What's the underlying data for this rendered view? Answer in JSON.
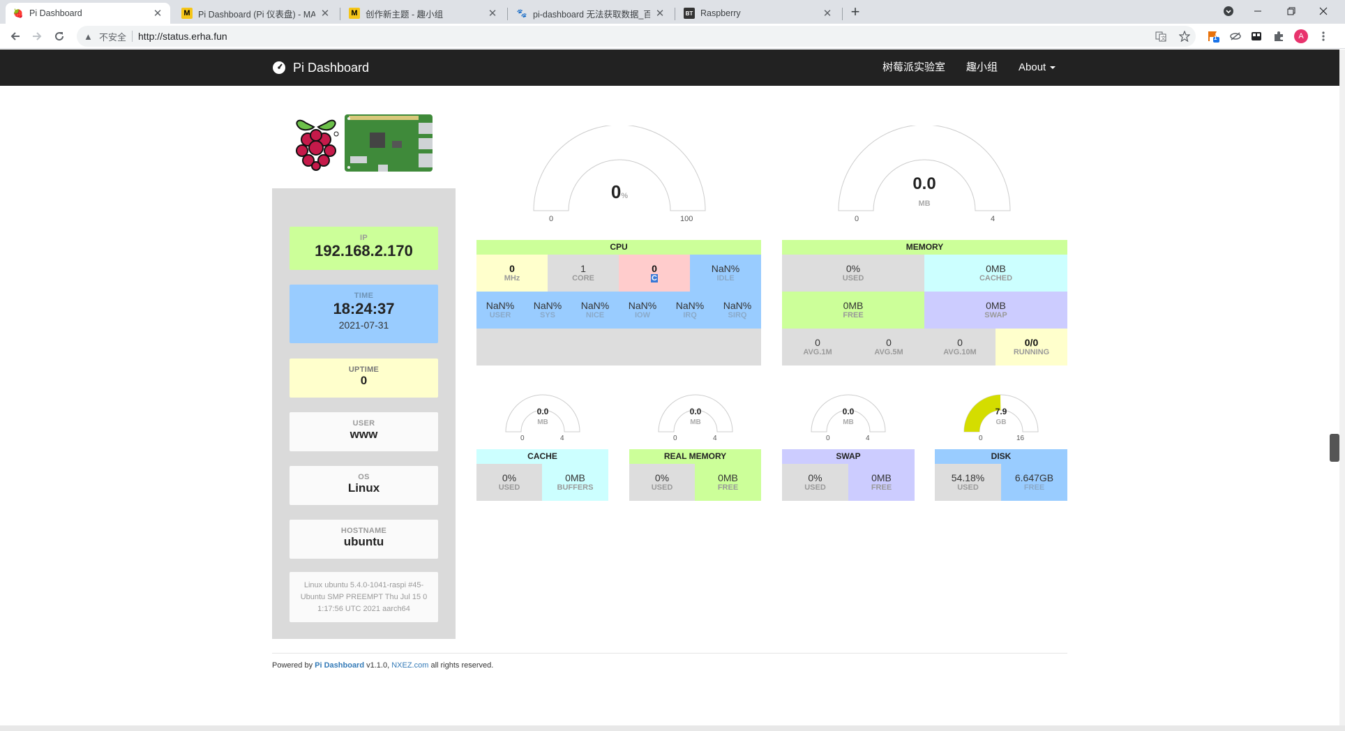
{
  "browser": {
    "tabs": [
      {
        "title": "Pi Dashboard",
        "active": true
      },
      {
        "title": "Pi Dashboard (Pi 仪表盘) - MA"
      },
      {
        "title": "创作新主题 - 趣小组"
      },
      {
        "title": "pi-dashboard 无法获取数据_百"
      },
      {
        "title": "Raspberry"
      }
    ],
    "favicons": [
      "🍓",
      "M",
      "M",
      "🐾",
      "BT"
    ],
    "new_tab": "+",
    "not_secure": "不安全",
    "url": "http://status.erha.fun",
    "profile_initial": "A",
    "ext_badge": "1"
  },
  "navbar": {
    "brand": "Pi Dashboard",
    "links": [
      "树莓派实验室",
      "趣小组",
      "About"
    ]
  },
  "sidebar": {
    "ip_label": "IP",
    "ip": "192.168.2.170",
    "time_label": "TIME",
    "time": "18:24:37",
    "date": "2021-07-31",
    "uptime_label": "UPTIME",
    "uptime": "0",
    "user_label": "USER",
    "user": "www",
    "os_label": "OS",
    "os": "Linux",
    "hostname_label": "HOSTNAME",
    "hostname": "ubuntu",
    "kernel_lines": [
      "Linux ubuntu 5.4.0-1041-raspi #45-",
      "Ubuntu SMP PREEMPT Thu Jul 15 0",
      "1:17:56 UTC 2021 aarch64"
    ]
  },
  "cpu_gauge": {
    "value": "0",
    "unit": "%",
    "min": "0",
    "max": "100",
    "fraction": 0
  },
  "mem_gauge": {
    "value": "0.0",
    "unit": "MB",
    "min": "0",
    "max": "4",
    "fraction": 0
  },
  "cpu": {
    "title": "CPU",
    "row1": [
      {
        "value": "0",
        "label": "MHz"
      },
      {
        "value": "1",
        "label": "CORE"
      },
      {
        "value": "0",
        "label": "C"
      },
      {
        "value": "NaN%",
        "label": "IDLE"
      }
    ],
    "row2": [
      {
        "value": "NaN%",
        "label": "USER"
      },
      {
        "value": "NaN%",
        "label": "SYS"
      },
      {
        "value": "NaN%",
        "label": "NICE"
      },
      {
        "value": "NaN%",
        "label": "IOW"
      },
      {
        "value": "NaN%",
        "label": "IRQ"
      },
      {
        "value": "NaN%",
        "label": "SIRQ"
      }
    ]
  },
  "memory": {
    "title": "MEMORY",
    "used": {
      "value": "0%",
      "label": "USED"
    },
    "cached": {
      "value": "0MB",
      "label": "CACHED"
    },
    "free": {
      "value": "0MB",
      "label": "FREE"
    },
    "swap": {
      "value": "0MB",
      "label": "SWAP"
    },
    "loads": [
      {
        "value": "0",
        "label": "AVG.1M"
      },
      {
        "value": "0",
        "label": "AVG.5M"
      },
      {
        "value": "0",
        "label": "AVG.10M"
      },
      {
        "value": "0/0",
        "label": "RUNNING"
      }
    ]
  },
  "small": [
    {
      "title": "CACHE",
      "gauge": {
        "value": "0.0",
        "unit": "MB",
        "min": "0",
        "max": "4",
        "fraction": 0
      },
      "a": {
        "value": "0%",
        "label": "USED"
      },
      "b": {
        "value": "0MB",
        "label": "BUFFERS"
      },
      "color": "#ccffff"
    },
    {
      "title": "REAL MEMORY",
      "gauge": {
        "value": "0.0",
        "unit": "MB",
        "min": "0",
        "max": "4",
        "fraction": 0
      },
      "a": {
        "value": "0%",
        "label": "USED"
      },
      "b": {
        "value": "0MB",
        "label": "FREE"
      },
      "color": "#ccff99"
    },
    {
      "title": "SWAP",
      "gauge": {
        "value": "0.0",
        "unit": "MB",
        "min": "0",
        "max": "4",
        "fraction": 0
      },
      "a": {
        "value": "0%",
        "label": "USED"
      },
      "b": {
        "value": "0MB",
        "label": "FREE"
      },
      "color": "#ccccff"
    },
    {
      "title": "DISK",
      "gauge": {
        "value": "7.9",
        "unit": "GB",
        "min": "0",
        "max": "16",
        "fraction": 0.4937
      },
      "a": {
        "value": "54.18%",
        "label": "USED"
      },
      "b": {
        "value": "6.647GB",
        "label": "FREE"
      },
      "color": "#99ccff"
    }
  ],
  "footer": {
    "prefix": "Powered by ",
    "product": "Pi Dashboard",
    "version": " v1.1.0, ",
    "site": "NXEZ.com",
    "suffix": " all rights reserved."
  },
  "colors": {
    "green": "#ccff99",
    "blue": "#99ccff",
    "yellow": "#ffffcc",
    "pink": "#ffcccc",
    "gray": "#dddddd",
    "cyan": "#ccffff",
    "lavender": "#ccccff",
    "gauge_fill": "#d4dd00"
  }
}
